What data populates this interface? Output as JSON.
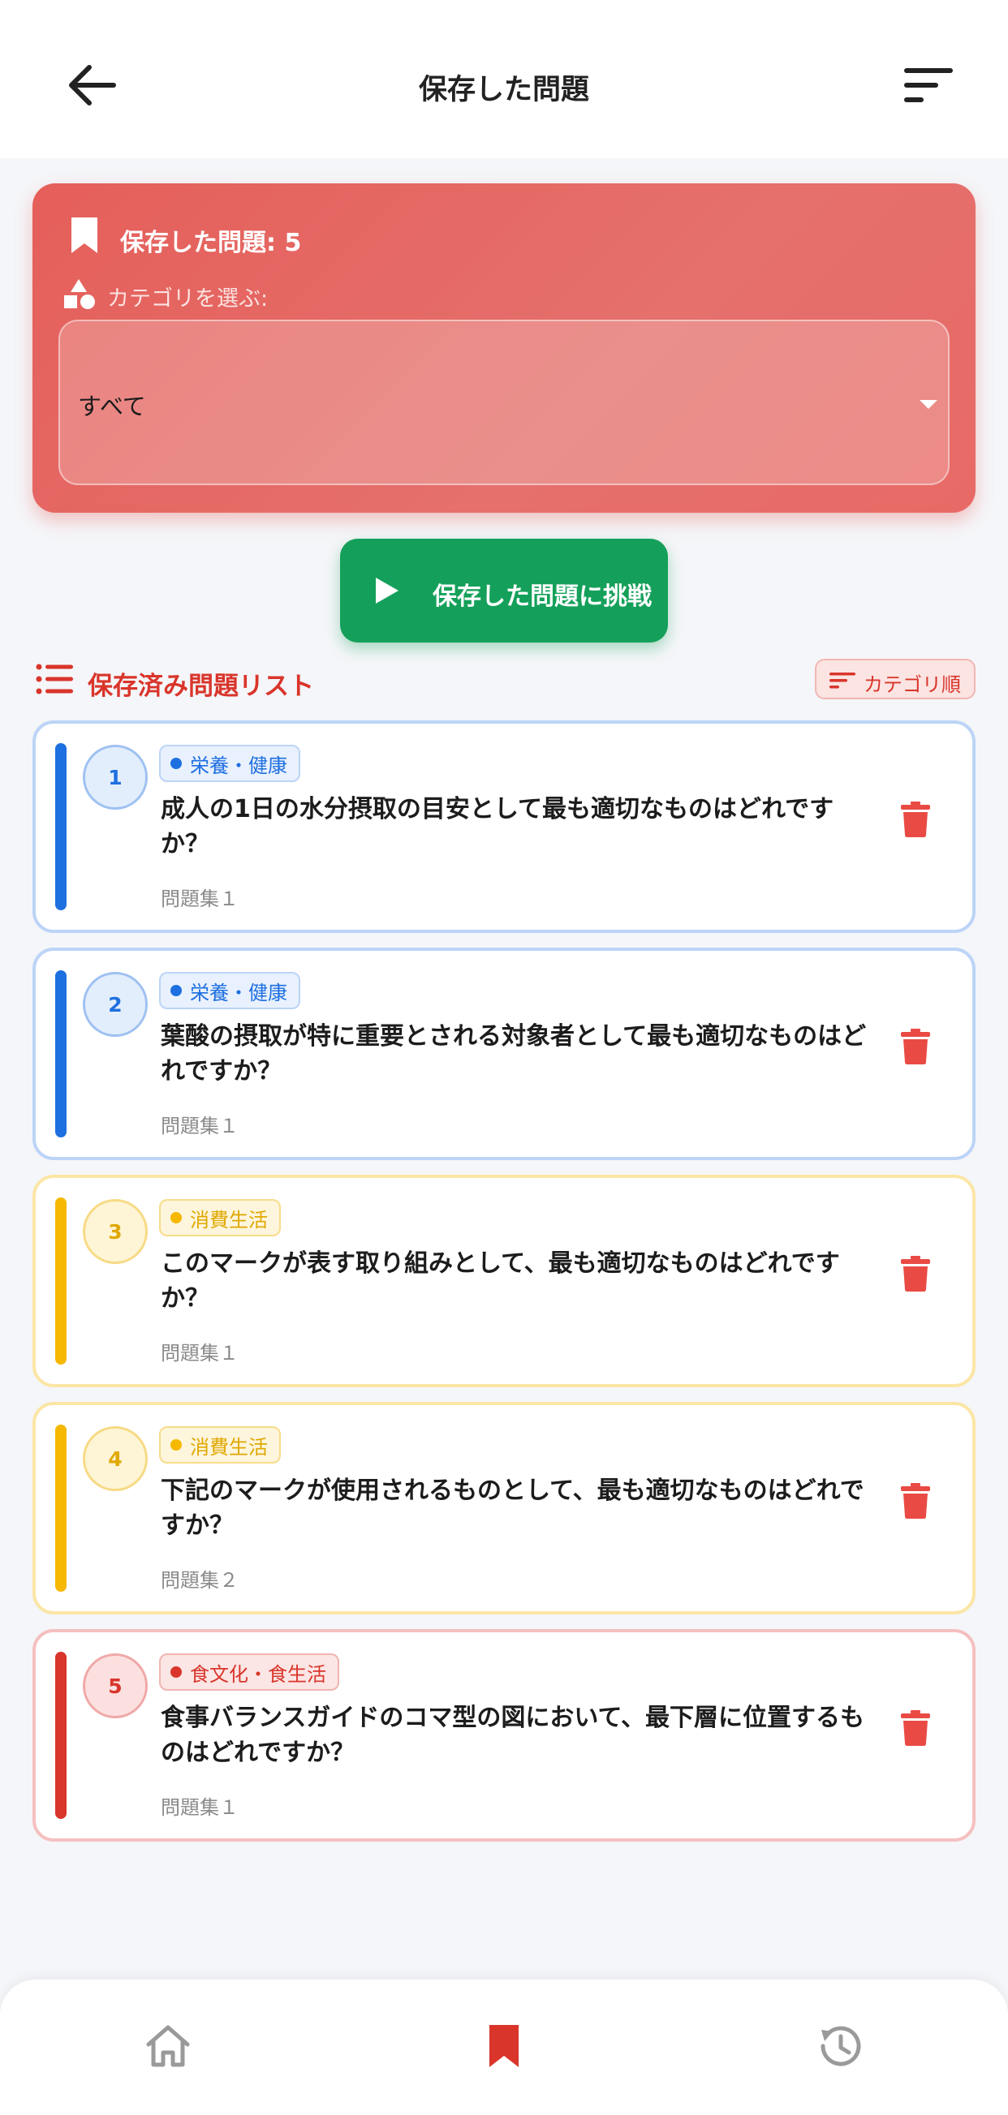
{
  "appbar": {
    "title": "保存した問題",
    "back_icon": "arrow-left-icon",
    "sort_icon": "sort-lines-icon"
  },
  "header_card": {
    "count_label": "保存した問題: 5",
    "category_label": "カテゴリを選ぶ:",
    "select_value": "すべて",
    "colors": {
      "gradient_start": "#e55f5a",
      "gradient_end": "#e86a66"
    }
  },
  "challenge_button": {
    "label": "保存した問題に挑戦",
    "color": "#14a05a"
  },
  "list_header": {
    "title": "保存済み問題リスト",
    "sort_chip": "カテゴリ順",
    "accent": "#d9352b"
  },
  "questions": [
    {
      "number": "1",
      "category": "栄養・健康",
      "text": "成人の1日の水分摂取の目安として最も適切なものはどれですか？",
      "set": "問題集１",
      "color": "blue"
    },
    {
      "number": "2",
      "category": "栄養・健康",
      "text": "葉酸の摂取が特に重要とされる対象者として最も適切なものはどれですか？",
      "set": "問題集１",
      "color": "blue"
    },
    {
      "number": "3",
      "category": "消費生活",
      "text": "このマークが表す取り組みとして、最も適切なものはどれですか？",
      "set": "問題集１",
      "color": "yellow"
    },
    {
      "number": "4",
      "category": "消費生活",
      "text": "下記のマークが使用されるものとして、最も適切なものはどれですか？",
      "set": "問題集２",
      "color": "yellow"
    },
    {
      "number": "5",
      "category": "食文化・食生活",
      "text": "食事バランスガイドのコマ型の図において、最下層に位置するものはどれですか？",
      "set": "問題集１",
      "color": "red"
    }
  ],
  "bottom_nav": {
    "items": [
      {
        "icon": "home-icon",
        "active": false
      },
      {
        "icon": "bookmark-icon",
        "active": true
      },
      {
        "icon": "history-icon",
        "active": false
      }
    ],
    "active_color": "#d9352b",
    "inactive_color": "#9a9a9a"
  }
}
